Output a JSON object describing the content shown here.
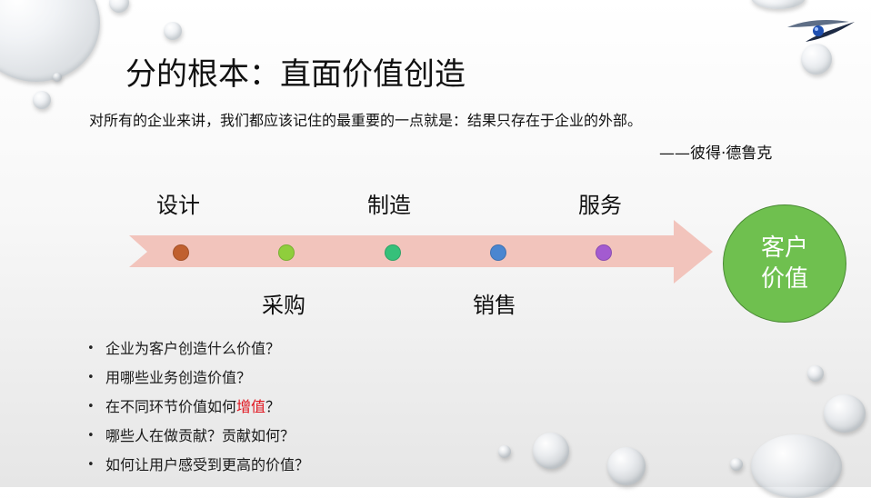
{
  "slide": {
    "title": "分的根本：直面价值创造",
    "quote": "对所有的企业来讲，我们都应该记住的最重要的一点就是：结果只存在于企业的外部。",
    "author": "——彼得·德鲁克"
  },
  "process": {
    "steps": [
      "设计",
      "采购",
      "制造",
      "销售",
      "服务"
    ],
    "node_colors": [
      "#c0602f",
      "#8fce3c",
      "#36c07a",
      "#4a86d0",
      "#a35bd0"
    ],
    "arrow_color": "#f2c4bc",
    "result": "客户\n价值",
    "result_color": "#6fc04f"
  },
  "questions": [
    {
      "before": "企业为客户创造什么价值？",
      "highlight": "",
      "after": ""
    },
    {
      "before": "用哪些业务创造价值？",
      "highlight": "",
      "after": ""
    },
    {
      "before": "在不同环节价值如何",
      "highlight": "增值",
      "after": "？"
    },
    {
      "before": "哪些人在做贡献？贡献如何？",
      "highlight": "",
      "after": ""
    },
    {
      "before": "如何让用户感受到更高的价值？",
      "highlight": "",
      "after": ""
    }
  ],
  "colors": {
    "highlight": "#e0141e"
  }
}
